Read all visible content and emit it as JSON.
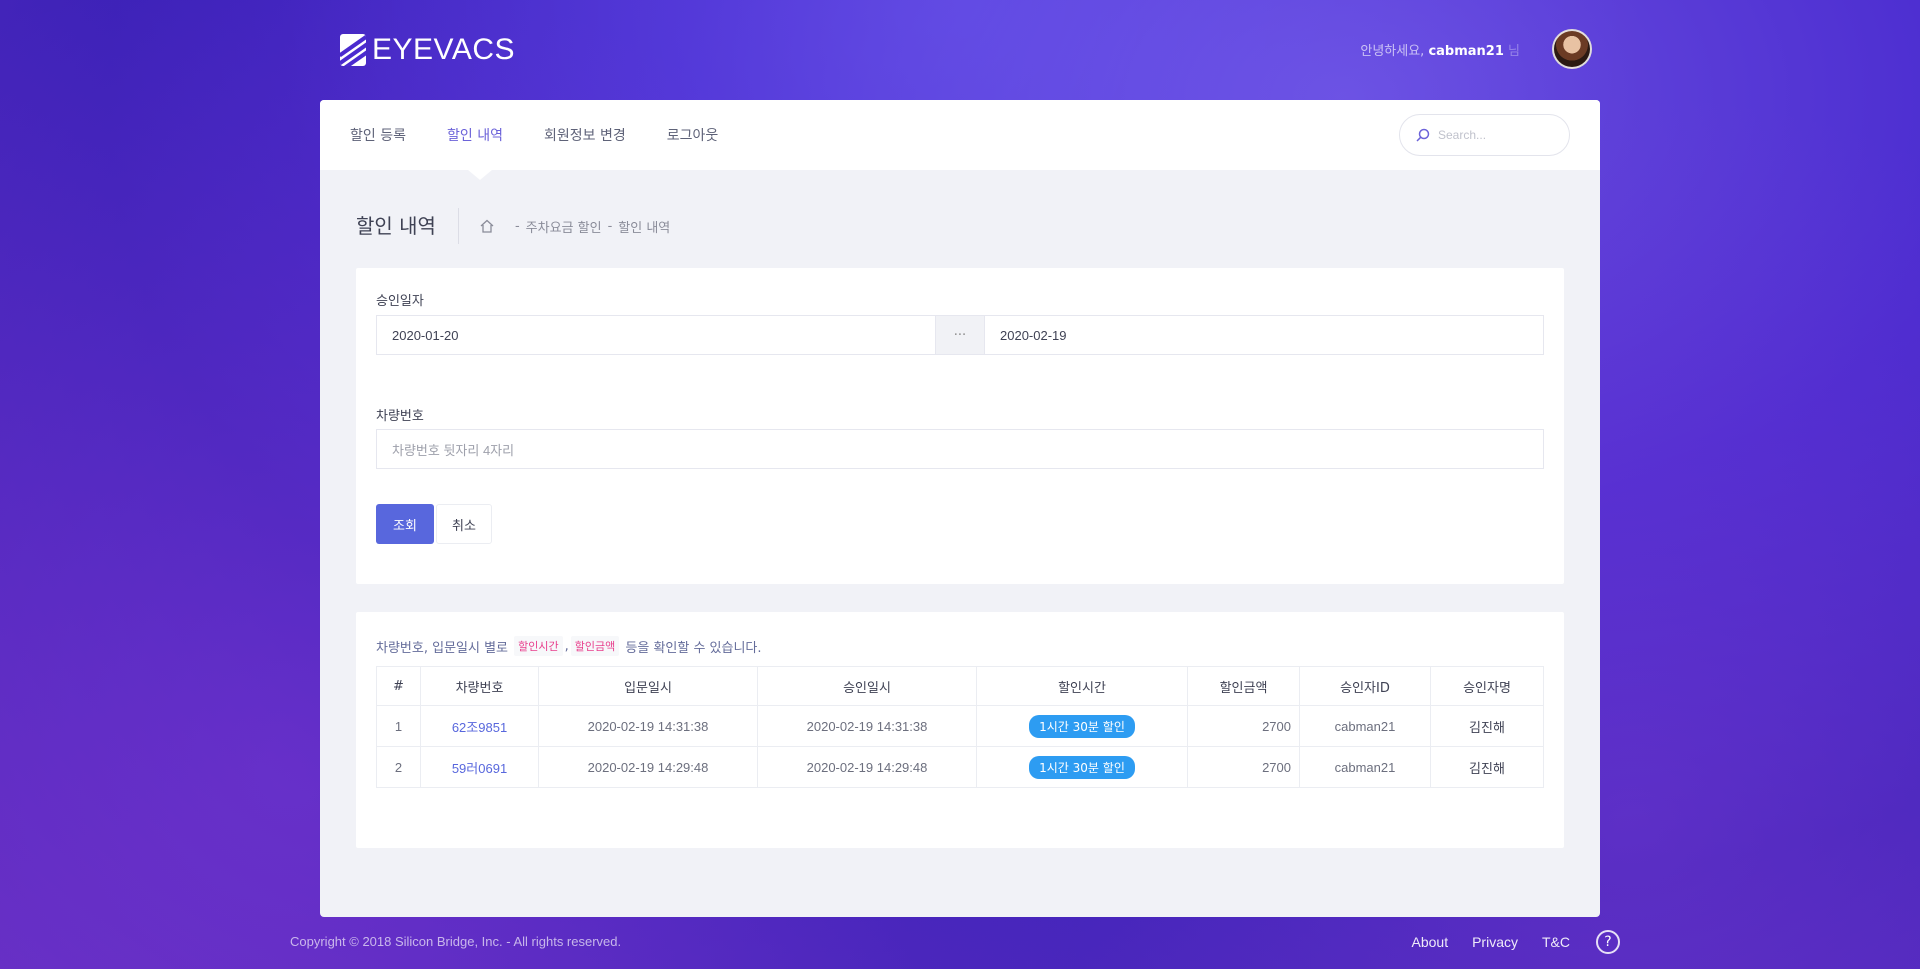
{
  "brand": {
    "name": "EYEVACS"
  },
  "header": {
    "greeting": "안녕하세요,",
    "username": "cabman21",
    "suffix": "님"
  },
  "nav": {
    "items": [
      {
        "label": "할인 등록",
        "active": false
      },
      {
        "label": "할인 내역",
        "active": true
      },
      {
        "label": "회원정보 변경",
        "active": false
      },
      {
        "label": "로그아웃",
        "active": false
      }
    ],
    "search_placeholder": "Search..."
  },
  "subheader": {
    "title": "할인 내역",
    "breadcrumb": [
      "주차요금 할인",
      "할인 내역"
    ]
  },
  "filter": {
    "date_label": "승인일자",
    "date_from": "2020-01-20",
    "range_sep": "···",
    "date_to": "2020-02-19",
    "plate_label": "차량번호",
    "plate_placeholder": "차량번호 뒷자리 4자리",
    "search_button": "조회",
    "cancel_button": "취소"
  },
  "results": {
    "desc_before": "차량번호, 입문일시 별로",
    "code1": "할인시간",
    "code_sep": ",",
    "code2": "할인금액",
    "desc_after": "등을 확인할 수 있습니다.",
    "columns": [
      "#",
      "차량번호",
      "입문일시",
      "승인일시",
      "할인시간",
      "할인금액",
      "승인자ID",
      "승인자명"
    ],
    "rows": [
      {
        "no": "1",
        "plate": "62조9851",
        "entry": "2020-02-19 14:31:38",
        "approved": "2020-02-19 14:31:38",
        "discount_time": "1시간 30분 할인",
        "amount": "2700",
        "approver_id": "cabman21",
        "approver_name": "김진해"
      },
      {
        "no": "2",
        "plate": "59러0691",
        "entry": "2020-02-19 14:29:48",
        "approved": "2020-02-19 14:29:48",
        "discount_time": "1시간 30분 할인",
        "amount": "2700",
        "approver_id": "cabman21",
        "approver_name": "김진해"
      }
    ]
  },
  "footer": {
    "copyright": "Copyright © 2018 Silicon Bridge, Inc. - All rights reserved.",
    "links": [
      "About",
      "Privacy",
      "T&C"
    ],
    "help": "?"
  },
  "colors": {
    "accent": "#5867dd",
    "nav_active": "#6c63d9",
    "pill": "#2d9cf2"
  }
}
